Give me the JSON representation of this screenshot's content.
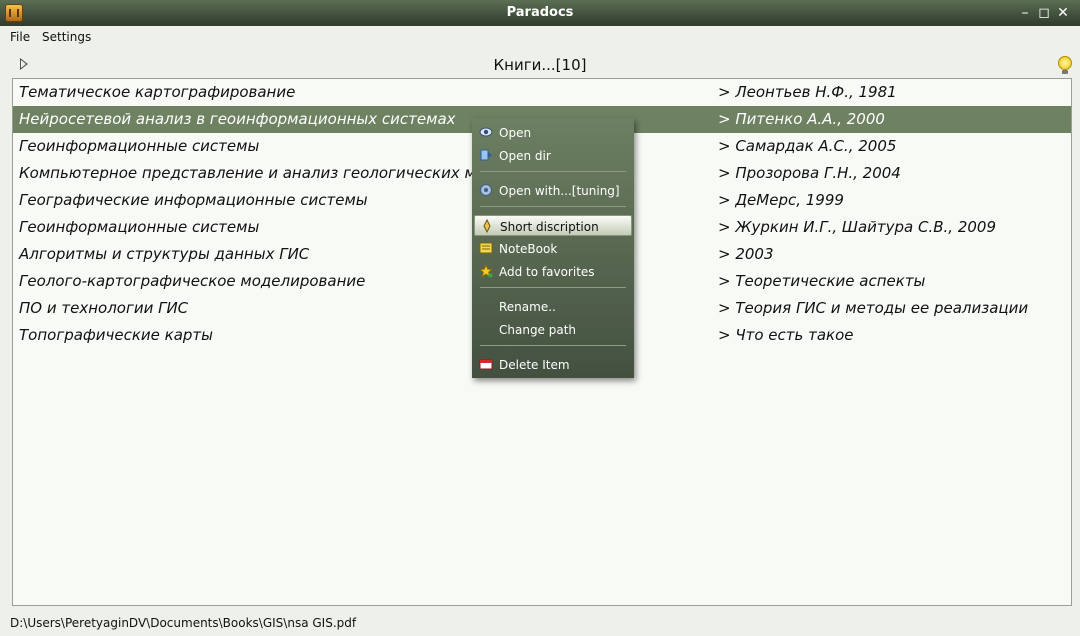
{
  "window": {
    "title": "Paradocs"
  },
  "menubar": {
    "items": [
      "File",
      "Settings"
    ]
  },
  "toolbar": {
    "heading": "Книги...[10]"
  },
  "books": [
    {
      "title": "Тематическое картографирование",
      "meta": "> Леонтьев Н.Ф., 1981"
    },
    {
      "title": "Нейросетевой анализ в геоинформационных системах",
      "meta": "> Питенко А.А., 2000"
    },
    {
      "title": "Геоинформационные системы",
      "meta": "> Самардак А.С., 2005"
    },
    {
      "title": "Компьютерное представление и анализ геологических материалов",
      "meta": "> Прозорова Г.Н., 2004"
    },
    {
      "title": "Географические информационные системы",
      "meta": "> ДеМерс, 1999"
    },
    {
      "title": "Геоинформационные системы",
      "meta": "> Журкин И.Г., Шайтура С.В., 2009"
    },
    {
      "title": "Алгоритмы и структуры данных ГИС",
      "meta": "> 2003"
    },
    {
      "title": "Геолого-картографическое моделирование",
      "meta": "> Теоретические аспекты"
    },
    {
      "title": "ПО и технологии ГИС",
      "meta": "> Теория ГИС и методы ее реализации"
    },
    {
      "title": "Топографические карты",
      "meta": "> Что есть такое"
    }
  ],
  "selected_index": 1,
  "context_menu": {
    "items": [
      {
        "label": "Open",
        "icon": "eye-icon"
      },
      {
        "label": "Open dir",
        "icon": "open-dir-icon"
      },
      {
        "label": "Open with...[tuning]",
        "icon": "gear-icon"
      },
      {
        "label": "Short discription",
        "icon": "pen-icon"
      },
      {
        "label": "NoteBook",
        "icon": "notebook-icon"
      },
      {
        "label": "Add to favorites",
        "icon": "star-icon"
      },
      {
        "label": "Rename..",
        "icon": ""
      },
      {
        "label": "Change path",
        "icon": ""
      },
      {
        "label": "Delete Item",
        "icon": "delete-icon"
      }
    ],
    "highlighted_index": 3
  },
  "status": {
    "path": "D:\\Users\\PeretyaginDV\\Documents\\Books\\GIS\\nsa GIS.pdf"
  },
  "colors": {
    "selection": "#6e8262",
    "menu_bg": "#5b6d52",
    "accent_bulb": "#e8c20f"
  }
}
